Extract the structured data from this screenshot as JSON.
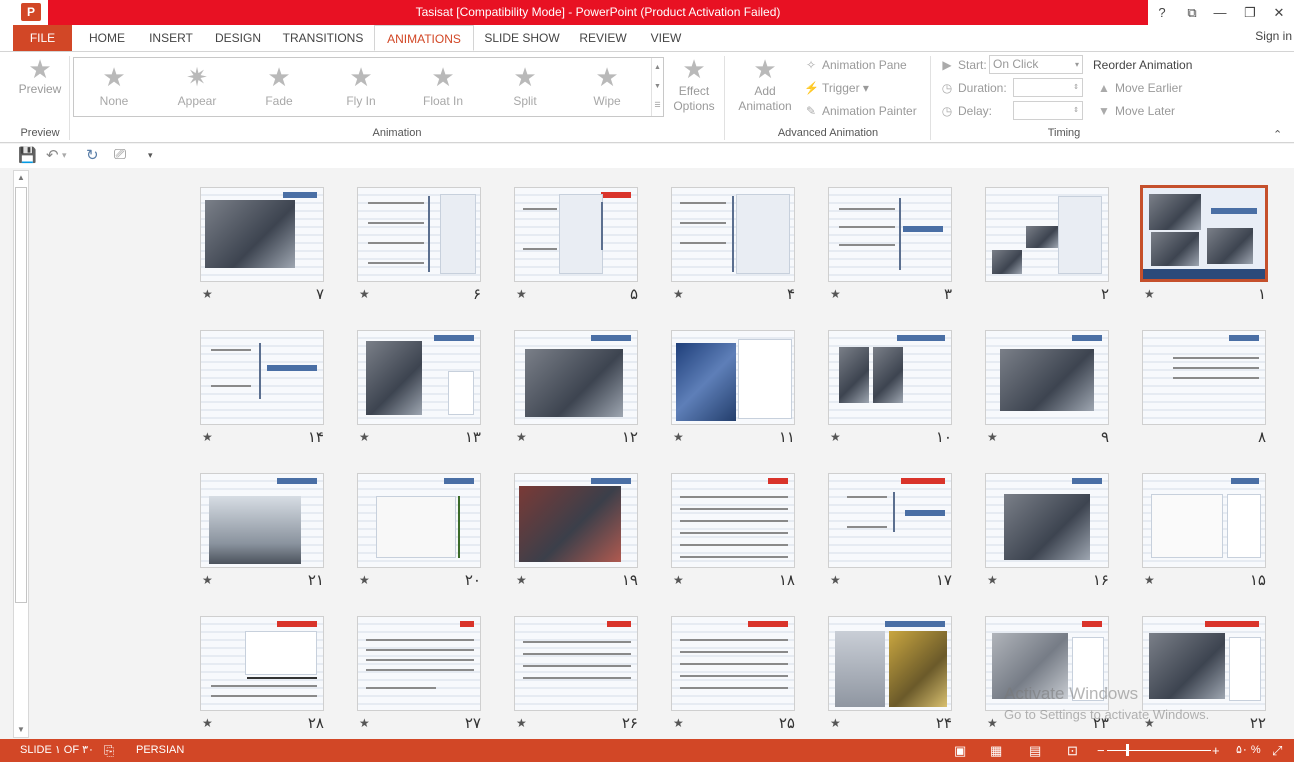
{
  "window": {
    "title": "Tasisat [Compatibility Mode] -  PowerPoint (Product Activation Failed)",
    "app_icon": "P",
    "help": "?",
    "ribbon_display": "⧉",
    "minimize": "—",
    "maximize": "❐",
    "close": "✕"
  },
  "tabs": [
    {
      "label": "FILE"
    },
    {
      "label": "HOME"
    },
    {
      "label": "INSERT"
    },
    {
      "label": "DESIGN"
    },
    {
      "label": "TRANSITIONS"
    },
    {
      "label": "ANIMATIONS"
    },
    {
      "label": "SLIDE SHOW"
    },
    {
      "label": "REVIEW"
    },
    {
      "label": "VIEW"
    }
  ],
  "signin": "Sign in",
  "ribbon": {
    "preview": {
      "button": "Preview",
      "group": "Preview"
    },
    "animation": {
      "group": "Animation",
      "items": [
        "None",
        "Appear",
        "Fade",
        "Fly In",
        "Float In",
        "Split",
        "Wipe"
      ],
      "effect_options": "Effect Options"
    },
    "advanced": {
      "group": "Advanced Animation",
      "add_animation": "Add Animation",
      "animation_pane": "Animation Pane",
      "trigger": "Trigger",
      "animation_painter": "Animation Painter"
    },
    "timing": {
      "group": "Timing",
      "start_label": "Start:",
      "start_value": "On Click",
      "duration_label": "Duration:",
      "delay_label": "Delay:",
      "reorder": "Reorder Animation",
      "move_earlier": "Move Earlier",
      "move_later": "Move Later"
    }
  },
  "slides": [
    {
      "num": "۱",
      "star": "★",
      "selected": true
    },
    {
      "num": "۲",
      "star": ""
    },
    {
      "num": "۳",
      "star": "★"
    },
    {
      "num": "۴",
      "star": "★"
    },
    {
      "num": "۵",
      "star": "★"
    },
    {
      "num": "۶",
      "star": "★"
    },
    {
      "num": "۷",
      "star": "★"
    },
    {
      "num": "۸",
      "star": ""
    },
    {
      "num": "۹",
      "star": "★"
    },
    {
      "num": "۱۰",
      "star": "★"
    },
    {
      "num": "۱۱",
      "star": "★"
    },
    {
      "num": "۱۲",
      "star": "★"
    },
    {
      "num": "۱۳",
      "star": "★"
    },
    {
      "num": "۱۴",
      "star": "★"
    },
    {
      "num": "۱۵",
      "star": "★"
    },
    {
      "num": "۱۶",
      "star": "★"
    },
    {
      "num": "۱۷",
      "star": "★"
    },
    {
      "num": "۱۸",
      "star": "★"
    },
    {
      "num": "۱۹",
      "star": "★"
    },
    {
      "num": "۲۰",
      "star": "★"
    },
    {
      "num": "۲۱",
      "star": "★"
    },
    {
      "num": "۲۲",
      "star": "★"
    },
    {
      "num": "۲۳",
      "star": "★"
    },
    {
      "num": "۲۴",
      "star": "★"
    },
    {
      "num": "۲۵",
      "star": "★"
    },
    {
      "num": "۲۶",
      "star": "★"
    },
    {
      "num": "۲۷",
      "star": "★"
    },
    {
      "num": "۲۸",
      "star": "★"
    }
  ],
  "watermark": {
    "line1": "Activate Windows",
    "line2": "Go to Settings to activate Windows."
  },
  "status": {
    "slide_info": "SLIDE ۱ OF ۳۰",
    "language": "PERSIAN",
    "zoom": "۵۰ %"
  }
}
